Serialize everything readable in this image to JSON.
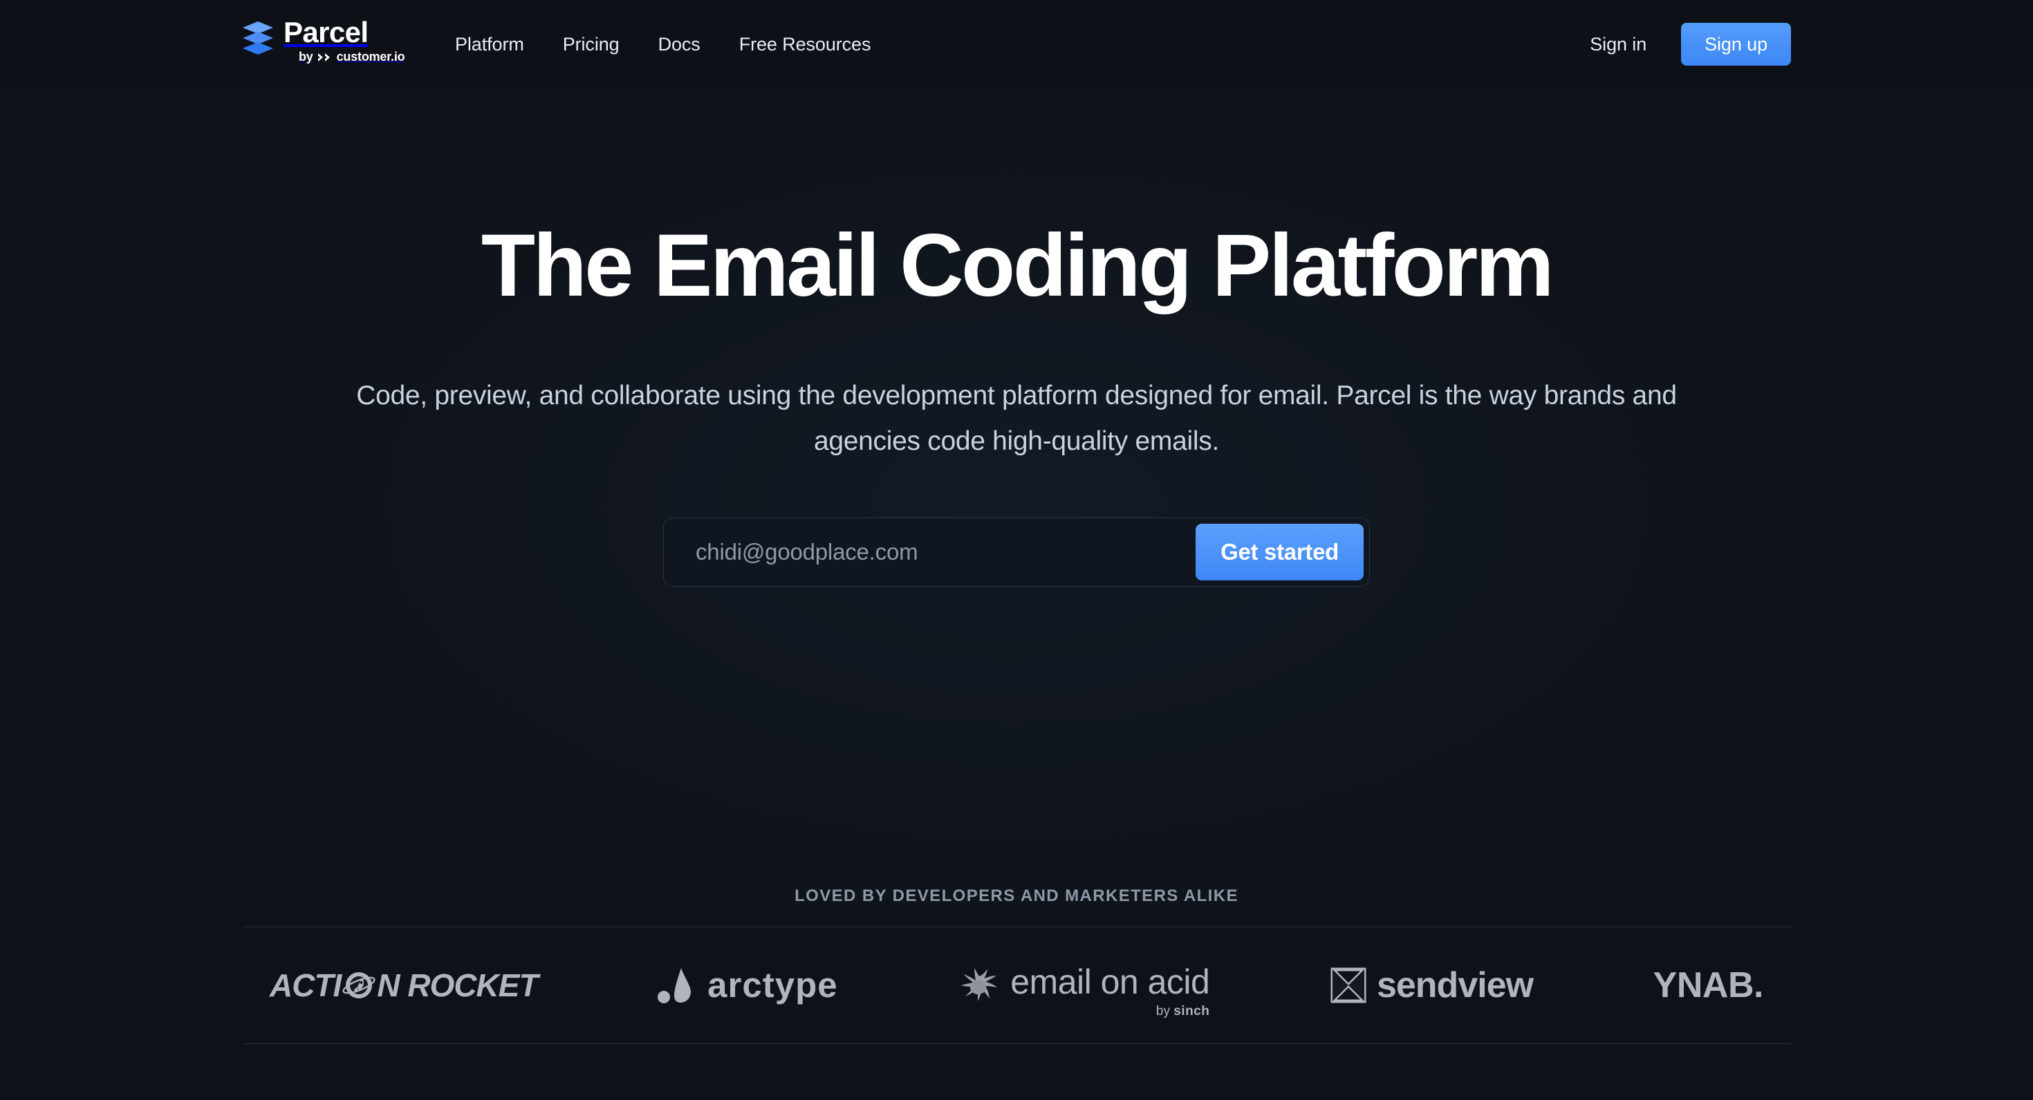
{
  "header": {
    "logo": {
      "mark": "stacked-layers-icon",
      "word": "Parcel",
      "by_prefix": "by",
      "by_brand": "customer.io"
    },
    "nav": [
      {
        "label": "Platform"
      },
      {
        "label": "Pricing"
      },
      {
        "label": "Docs"
      },
      {
        "label": "Free Resources"
      }
    ],
    "signin_label": "Sign in",
    "signup_label": "Sign up"
  },
  "hero": {
    "headline": "The Email Coding Platform",
    "subheadline": "Code, preview, and collaborate using the development platform designed for email. Parcel is the way brands and agencies code high-quality emails.",
    "email_placeholder": "chidi@goodplace.com",
    "email_value": "",
    "cta_label": "Get started"
  },
  "social_proof": {
    "label": "LOVED BY DEVELOPERS AND MARKETERS ALIKE",
    "brands": [
      {
        "name": "Action Rocket",
        "text_before": "ACTI",
        "text_after": "N ROCKET",
        "icon": "rocket-planet-icon"
      },
      {
        "name": "arctype",
        "word": "arctype",
        "icon": "arctype-flame-icon"
      },
      {
        "name": "email on acid",
        "word": "email on acid",
        "by_prefix": "by",
        "by_brand": "sinch",
        "icon": "acid-splat-icon"
      },
      {
        "name": "sendview",
        "word": "sendview",
        "icon": "sendview-x-icon"
      },
      {
        "name": "YNAB",
        "word": "YNAB."
      }
    ]
  },
  "colors": {
    "background": "#0e1218",
    "header_background": "#0d1117",
    "accent_blue": "#4a8cf7",
    "text_primary": "#ffffff",
    "text_secondary": "#c8d2e0",
    "text_muted": "#8e99a8",
    "logo_grey": "#b0b5bb",
    "border": "#2a3341"
  }
}
